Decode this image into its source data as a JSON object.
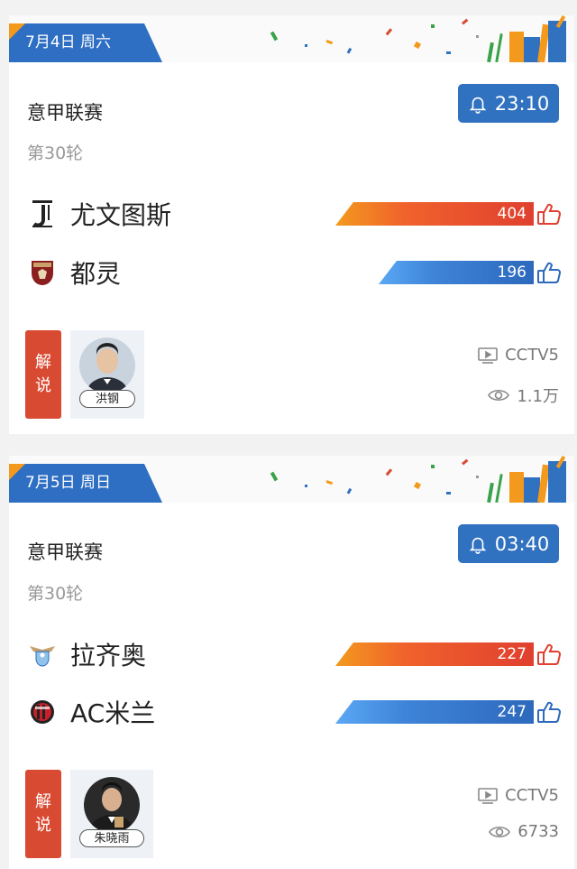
{
  "matches": [
    {
      "date": "7月4日 周六",
      "league": "意甲联赛",
      "round": "第30轮",
      "time": "23:10",
      "home": {
        "name": "尤文图斯",
        "logo": "juventus-logo",
        "votes": "404"
      },
      "away": {
        "name": "都灵",
        "logo": "torino-logo",
        "votes": "196"
      },
      "commentary_label": [
        "解",
        "说"
      ],
      "commentator": "洪钢",
      "channel": "CCTV5",
      "views": "1.1万"
    },
    {
      "date": "7月5日 周日",
      "league": "意甲联赛",
      "round": "第30轮",
      "time": "03:40",
      "home": {
        "name": "拉齐奥",
        "logo": "lazio-logo",
        "votes": "227"
      },
      "away": {
        "name": "AC米兰",
        "logo": "ac-milan-logo",
        "votes": "247"
      },
      "commentary_label": [
        "解",
        "说"
      ],
      "commentator": "朱晓雨",
      "channel": "CCTV5",
      "views": "6733"
    }
  ],
  "colors": {
    "primary_blue": "#3071c0",
    "vote_red": "#e0402f",
    "vote_blue": "#2d69bd",
    "commentary_red": "#d94a33",
    "accent_orange": "#f39a1e"
  },
  "icons": {
    "time": "bell-icon",
    "vote": "thumbs-up-icon",
    "channel": "tv-icon",
    "views": "eye-icon"
  }
}
